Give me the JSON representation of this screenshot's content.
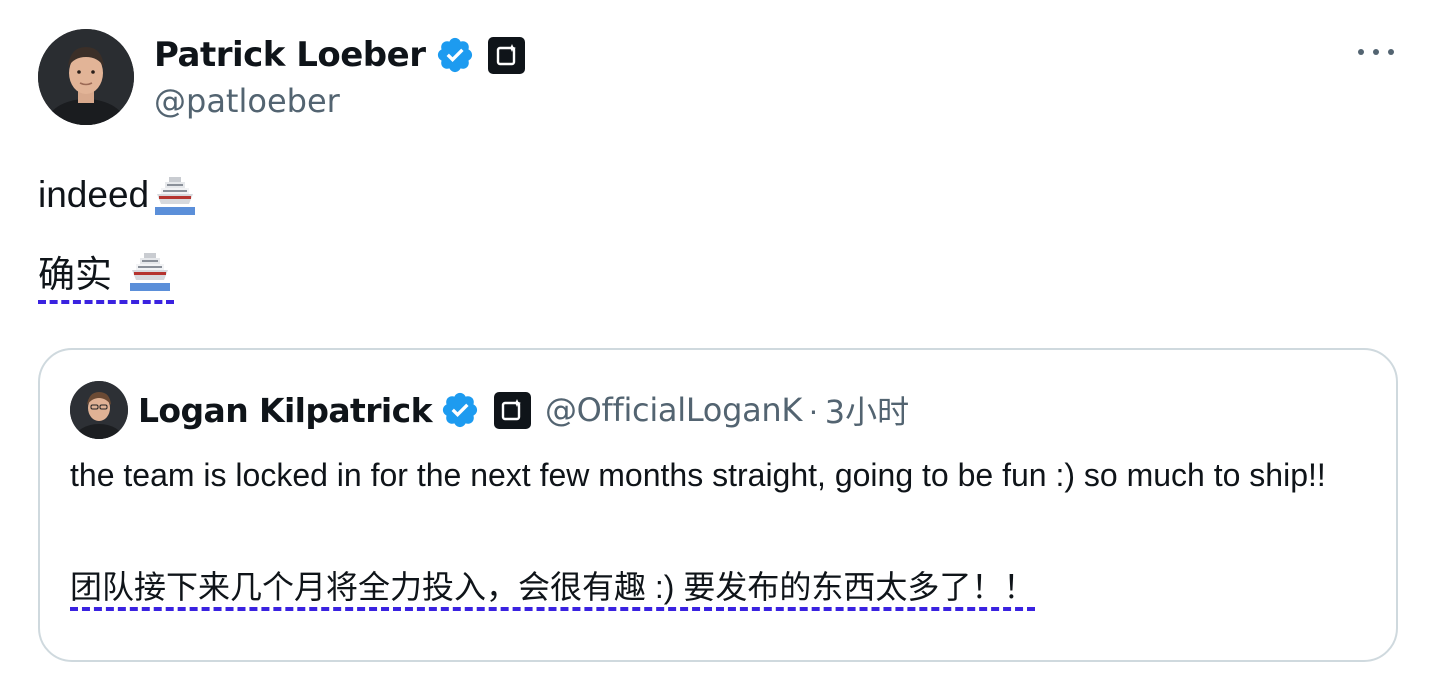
{
  "author": {
    "name": "Patrick Loeber",
    "handle": "@patloeber"
  },
  "post": {
    "text": "indeed",
    "translation": "确实"
  },
  "quoted": {
    "name": "Logan Kilpatrick",
    "handle": "@OfficialLoganK",
    "separator": "·",
    "time": "3小时",
    "text": "the team is locked in for the next few months straight, going to be fun :) so much to ship!!",
    "translation": "团队接下来几个月将全力投入，会很有趣 :) 要发布的东西太多了！！"
  },
  "icons": {
    "verified": "verified-badge-icon",
    "affiliate": "affiliate-badge-icon",
    "more": "more-icon",
    "ship": "ship-emoji"
  },
  "colors": {
    "text": "#0f1419",
    "muted": "#536471",
    "verified": "#1d9bf0",
    "border": "#cfd9de",
    "translation_underline": "#3a22e0"
  }
}
